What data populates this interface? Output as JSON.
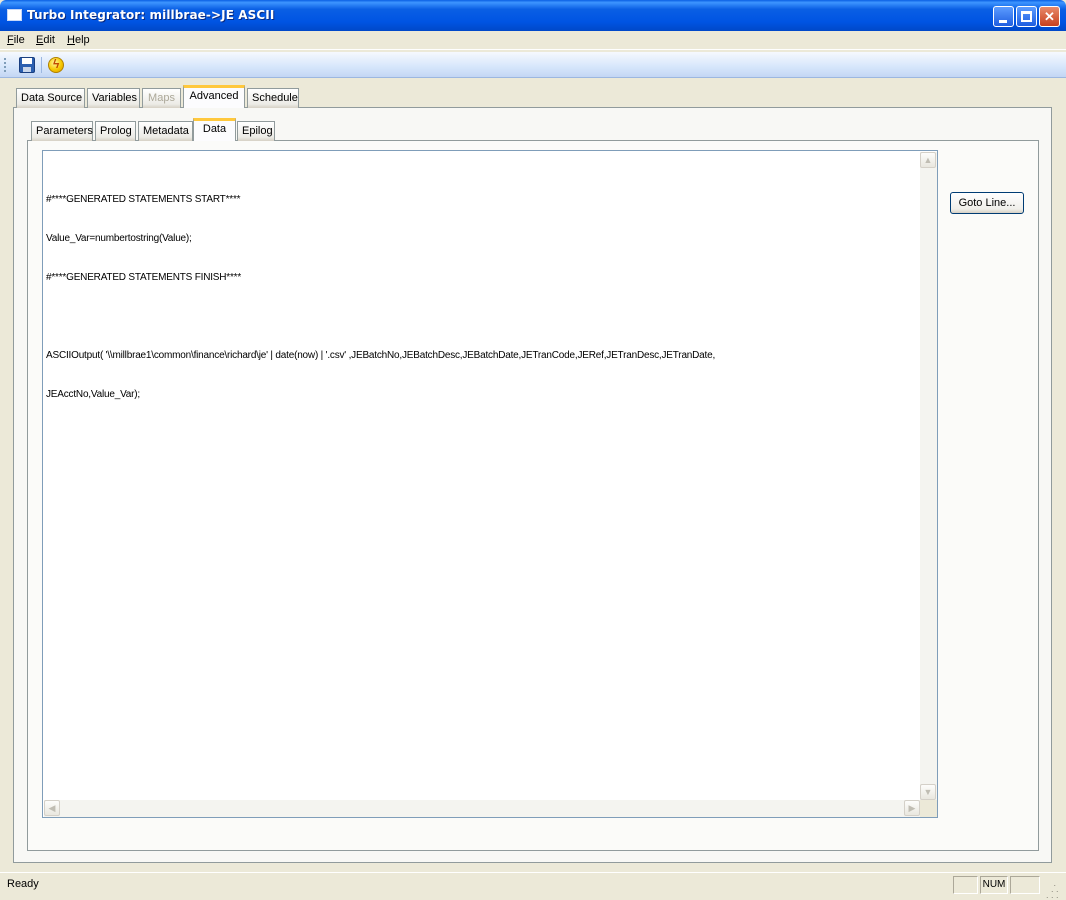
{
  "window": {
    "title": "Turbo Integrator:  millbrae->JE ASCII",
    "minimize_label": "",
    "maximize_label": "",
    "close_label": "✕"
  },
  "menu": {
    "file": {
      "u": "F",
      "rest": "ile"
    },
    "edit": {
      "u": "E",
      "rest": "dit"
    },
    "help": {
      "u": "H",
      "rest": "elp"
    }
  },
  "toolbar": {
    "save_icon": "save-disk-icon",
    "run_icon": "run-lightning-icon"
  },
  "main_tabs": [
    "Data Source",
    "Variables",
    "Maps",
    "Advanced",
    "Schedule"
  ],
  "main_tab_active": "Advanced",
  "main_tab_disabled": "Maps",
  "sub_tabs": [
    "Parameters",
    "Prolog",
    "Metadata",
    "Data",
    "Epilog"
  ],
  "sub_tab_active": "Data",
  "editor": {
    "lines": [
      "#****GENERATED STATEMENTS START****",
      "Value_Var=numbertostring(Value);",
      "#****GENERATED STATEMENTS FINISH****",
      "",
      "ASCIIOutput( '\\\\millbrae1\\common\\finance\\richard\\je' | date(now) | '.csv' ,JEBatchNo,JEBatchDesc,JEBatchDate,JETranCode,JERef,JETranDesc,JETranDate,",
      "JEAcctNo,Value_Var);"
    ]
  },
  "goto_button": "Goto Line...",
  "status": {
    "text": "Ready",
    "num_indicator": "NUM"
  },
  "colors": {
    "title_bar": "#0054e3",
    "active_tab_accent": "#ffc83c",
    "editor_border": "#7f9db9"
  }
}
